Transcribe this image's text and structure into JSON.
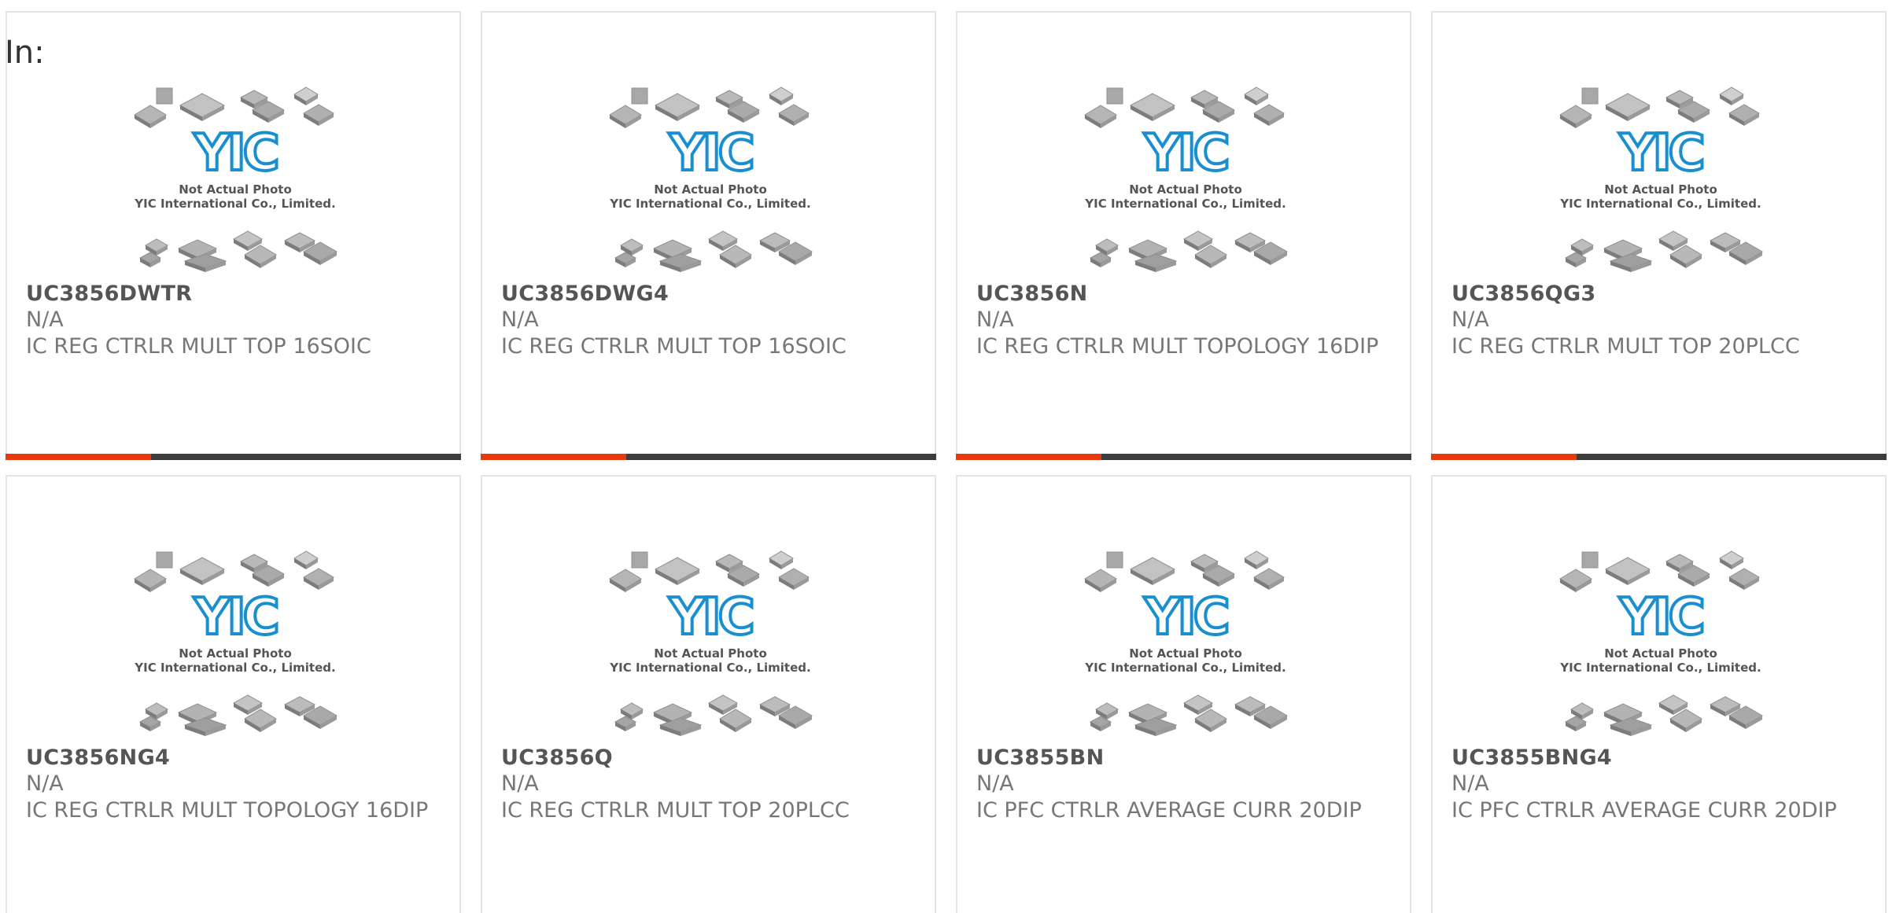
{
  "header": {
    "in_label": "In:"
  },
  "colors": {
    "accent": "#e8380d",
    "bar": "#3d3d3d",
    "logo_blue": "#1a8fd0"
  },
  "thumbnail": {
    "icon": "chip-placeholder-image",
    "line1": "Not Actual Photo",
    "line2": "YIC International Co., Limited.",
    "logo": "YIC"
  },
  "products": [
    {
      "part": "UC3856DWTR",
      "mfr": "N/A",
      "desc": "IC REG CTRLR MULT TOP 16SOIC"
    },
    {
      "part": "UC3856DWG4",
      "mfr": "N/A",
      "desc": "IC REG CTRLR MULT TOP 16SOIC"
    },
    {
      "part": "UC3856N",
      "mfr": "N/A",
      "desc": "IC REG CTRLR MULT TOPOLOGY 16DIP"
    },
    {
      "part": "UC3856QG3",
      "mfr": "N/A",
      "desc": "IC REG CTRLR MULT TOP 20PLCC"
    },
    {
      "part": "UC3856NG4",
      "mfr": "N/A",
      "desc": "IC REG CTRLR MULT TOPOLOGY 16DIP"
    },
    {
      "part": "UC3856Q",
      "mfr": "N/A",
      "desc": "IC REG CTRLR MULT TOP 20PLCC"
    },
    {
      "part": "UC3855BN",
      "mfr": "N/A",
      "desc": "IC PFC CTRLR AVERAGE CURR 20DIP"
    },
    {
      "part": "UC3855BNG4",
      "mfr": "N/A",
      "desc": "IC PFC CTRLR AVERAGE CURR 20DIP"
    }
  ]
}
